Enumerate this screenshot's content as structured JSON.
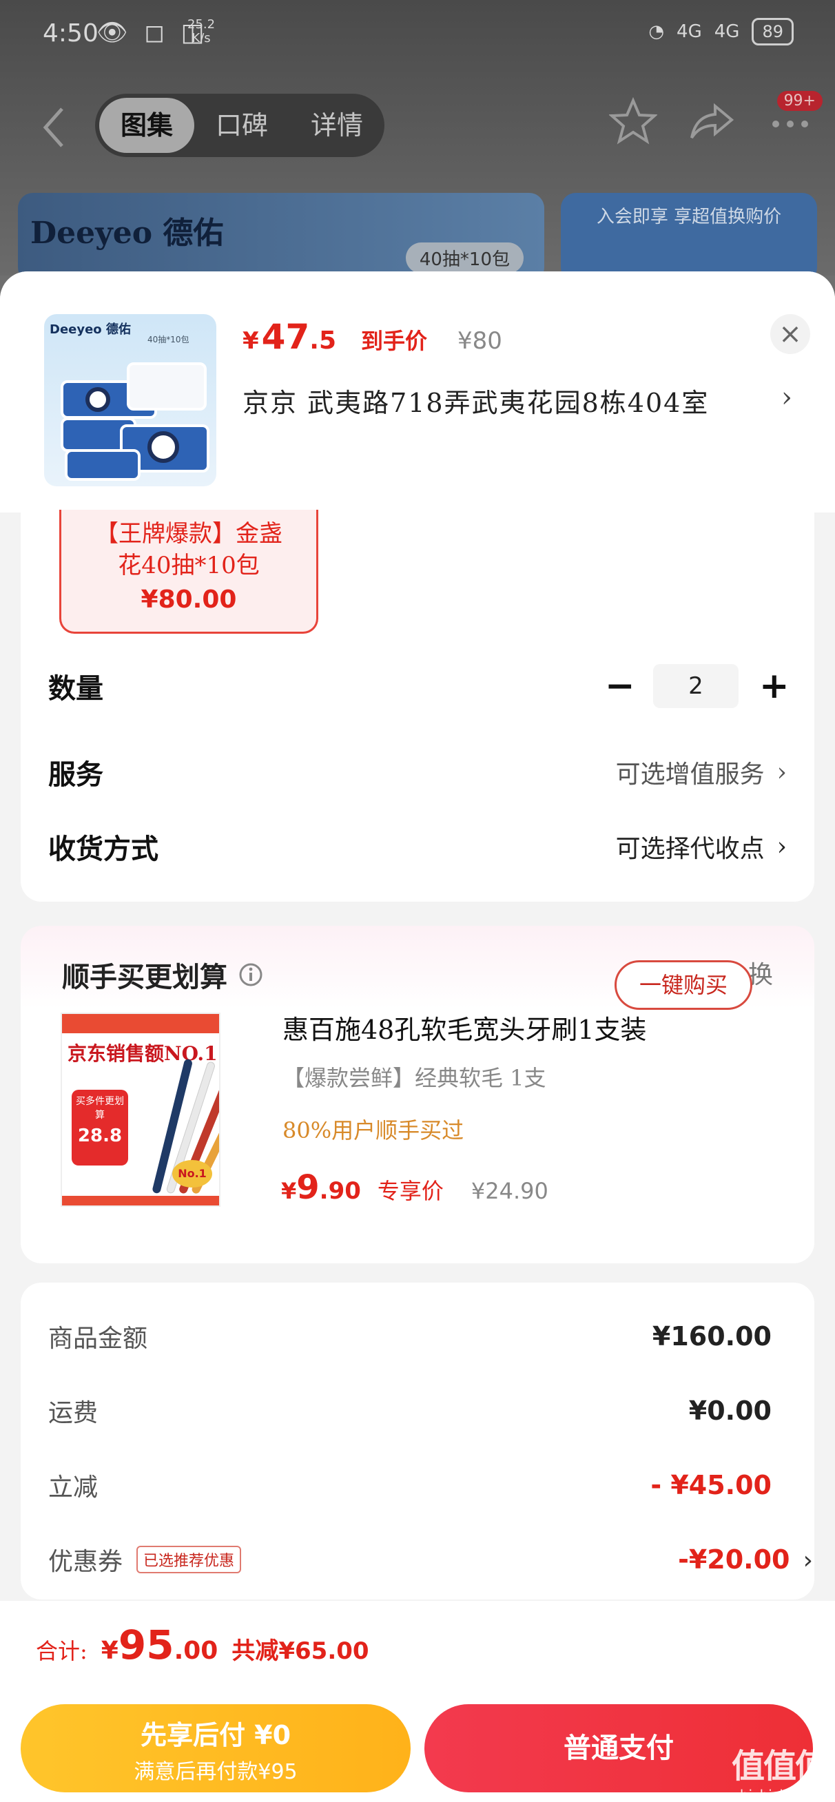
{
  "status_bar": {
    "time": "4:50",
    "speed": "25.2",
    "speed_unit": "K/s",
    "signal_1": "4G",
    "signal_2": "4G",
    "battery": "89"
  },
  "top_nav": {
    "tabs": [
      {
        "label": "图集",
        "active": true
      },
      {
        "label": "口碑",
        "active": false
      },
      {
        "label": "详情",
        "active": false
      }
    ],
    "badge": "99+"
  },
  "background_banner": {
    "brand": "Deeyeo 德佑",
    "pack_label": "40抽*10包",
    "promo": "入会即享 享超值换购价"
  },
  "product": {
    "thumb_brand": "Deeyeo 德佑",
    "thumb_pack": "40抽*10包",
    "price_yen": "¥",
    "price_int": "47",
    "price_dec": ".5",
    "price_label": "到手价",
    "original_price": "¥80",
    "address": "京京   武夷路718弄武夷花园8栋404室"
  },
  "spec": {
    "title": "【王牌爆款】金盏花40抽*10包",
    "price": "¥80.00"
  },
  "options": {
    "quantity_label": "数量",
    "quantity_value": "2",
    "service_label": "服务",
    "service_value": "可选增值服务",
    "delivery_label": "收货方式",
    "delivery_value": "可选择代收点"
  },
  "addon": {
    "title": "顺手买更划算",
    "swap_label": "换一换",
    "img_head": "京东销售额NO.1",
    "img_bubble_top": "买多件更划算",
    "img_bubble_price": "28.8",
    "img_no1": "No.1",
    "name": "惠百施48孔软毛宽头牙刷1支装",
    "sub": "【爆款尝鲜】经典软毛 1支",
    "stat": "80%用户顺手买过",
    "price_yen": "¥",
    "price_int": "9",
    "price_dec": ".90",
    "price_label": "专享价",
    "original_price": "¥24.90",
    "buy_label": "一键购买"
  },
  "summary": {
    "rows": [
      {
        "label": "商品金额",
        "value": "¥160.00"
      },
      {
        "label": "运费",
        "value": "¥0.00"
      },
      {
        "label": "立减",
        "value": "- ¥45.00"
      },
      {
        "label": "优惠券",
        "value": "-¥20.00",
        "tag": "已选推荐优惠"
      }
    ]
  },
  "footer": {
    "total_label": "合计:",
    "total_yen": "¥",
    "total_int": "95",
    "total_dec": ".00",
    "total_saved": "共减¥65.00",
    "pay_later_title": "先享后付 ¥0",
    "pay_later_sub": "满意后再付款¥95",
    "pay_normal": "普通支付"
  },
  "watermark": {
    "logo": "值值值",
    "site": "zhizhizhi.com"
  },
  "colors": {
    "accent": "#e2231a",
    "pay_later": "#ffb21a",
    "pay_normal": "#ee2f36",
    "stat": "#d88a2a"
  },
  "icons": [
    "back-arrow-icon",
    "star-icon",
    "share-icon",
    "more-icon",
    "close-icon",
    "chevron-right-icon",
    "minus-icon",
    "plus-icon",
    "info-icon",
    "refresh-icon"
  ]
}
